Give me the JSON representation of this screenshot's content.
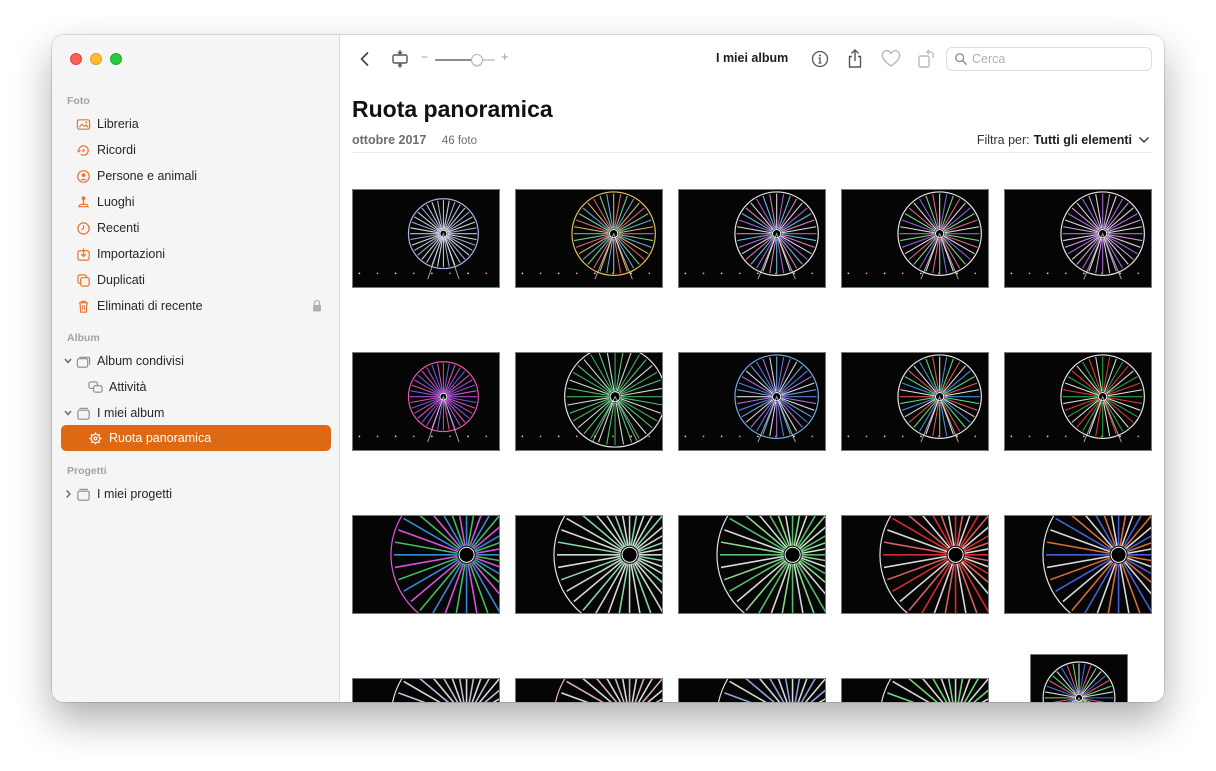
{
  "sidebar": {
    "sections": {
      "foto": "Foto",
      "album": "Album",
      "progetti": "Progetti"
    },
    "foto_items": [
      {
        "label": "Libreria",
        "icon": "photos-library-icon"
      },
      {
        "label": "Ricordi",
        "icon": "memories-icon"
      },
      {
        "label": "Persone e animali",
        "icon": "people-icon"
      },
      {
        "label": "Luoghi",
        "icon": "places-pin-icon"
      },
      {
        "label": "Recenti",
        "icon": "clock-icon"
      },
      {
        "label": "Importazioni",
        "icon": "import-icon"
      },
      {
        "label": "Duplicati",
        "icon": "duplicates-icon"
      },
      {
        "label": "Eliminati di recente",
        "icon": "trash-icon"
      }
    ],
    "album_items": {
      "shared": "Album condivisi",
      "activity": "Attività",
      "my_albums": "I miei album",
      "selected": "Ruota panoramica"
    },
    "project_items": {
      "my_projects": "I miei progetti"
    }
  },
  "toolbar": {
    "title": "I miei album",
    "search_placeholder": "Cerca",
    "zoom_minus": "−",
    "zoom_plus": "+",
    "zoom_level": 0.7
  },
  "album": {
    "title": "Ruota panoramica",
    "date": "ottobre 2017",
    "count": "46 foto",
    "filter_label": "Filtra per:",
    "filter_value": "Tutti gli elementi"
  },
  "colors": {
    "accent": "#dd6914",
    "icon_orange": "#e8762d"
  },
  "photos": [
    {
      "colors": [
        "#d8e4ff",
        "#ffffff",
        "#b9c9ff"
      ],
      "style": "small"
    },
    {
      "colors": [
        "#ff6b9d",
        "#8cf0a0",
        "#7ac0ff",
        "#ffd36b"
      ],
      "style": "mid"
    },
    {
      "colors": [
        "#c070ff",
        "#70e0ff",
        "#ff8fd8",
        "#ffffff"
      ],
      "style": "mid"
    },
    {
      "colors": [
        "#a070ff",
        "#80ff90",
        "#ff70a0",
        "#ffffff"
      ],
      "style": "mid"
    },
    {
      "colors": [
        "#c77dff",
        "#e8b6ff",
        "#ffffff"
      ],
      "style": "mid"
    },
    {
      "colors": [
        "#d050ff",
        "#7070ff",
        "#ff60c0"
      ],
      "style": "small"
    },
    {
      "colors": [
        "#48d070",
        "#60e890",
        "#ffffff"
      ],
      "style": "big"
    },
    {
      "colors": [
        "#6a8cff",
        "#d07cff",
        "#ffffff",
        "#80c0ff"
      ],
      "style": "mid"
    },
    {
      "colors": [
        "#50a8ff",
        "#60ff90",
        "#ff6060",
        "#ffffff"
      ],
      "style": "mid"
    },
    {
      "colors": [
        "#30c050",
        "#ff4040",
        "#ffffff"
      ],
      "style": "mid"
    },
    {
      "colors": [
        "#40a0ff",
        "#50e070",
        "#ff60ff"
      ],
      "style": "close"
    },
    {
      "colors": [
        "#e8fff0",
        "#a0ffc0",
        "#ffffff"
      ],
      "style": "close"
    },
    {
      "colors": [
        "#60e080",
        "#a0ffa0",
        "#ffffff"
      ],
      "style": "close"
    },
    {
      "colors": [
        "#ff3030",
        "#ff7070",
        "#ffffff"
      ],
      "style": "close"
    },
    {
      "colors": [
        "#5070ff",
        "#ff8040",
        "#ffffff"
      ],
      "style": "close"
    },
    {
      "colors": [
        "#e0e0ff",
        "#ffffff"
      ],
      "style": "close"
    },
    {
      "colors": [
        "#ffffff",
        "#ffd0d0"
      ],
      "style": "close"
    },
    {
      "colors": [
        "#a0c0ff",
        "#ffffff"
      ],
      "style": "close"
    },
    {
      "colors": [
        "#80ff90",
        "#ffffff"
      ],
      "style": "close"
    },
    {
      "colors": [
        "#5080ff",
        "#ff60a0",
        "#80ff80",
        "#ffffff"
      ],
      "style": "portrait"
    }
  ]
}
